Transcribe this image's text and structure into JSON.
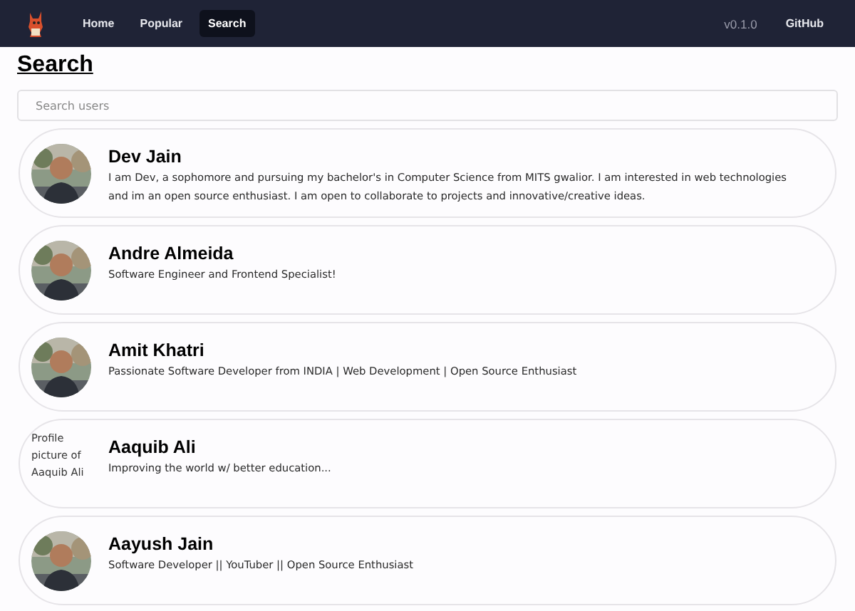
{
  "navbar": {
    "links": [
      {
        "label": "Home",
        "selected": false
      },
      {
        "label": "Popular",
        "selected": false
      },
      {
        "label": "Search",
        "selected": true
      }
    ],
    "version": "v0.1.0",
    "github": "GitHub"
  },
  "heading": "Search",
  "search": {
    "placeholder": "Search users"
  },
  "users": [
    {
      "name": "Dev Jain",
      "bio": "I am Dev, a sophomore and pursuing my bachelor's in Computer Science from MITS gwalior. I am interested in web technologies and im an open source enthusiast. I am open to collaborate to projects and innovative/creative ideas."
    },
    {
      "name": "Andre Almeida",
      "bio": "Software Engineer and Frontend Specialist!"
    },
    {
      "name": "Amit Khatri",
      "bio": "Passionate Software Developer from INDIA | Web Development | Open Source Enthusiast"
    },
    {
      "name": "Aaquib Ali",
      "bio": "Improving the world w/ better education...",
      "avatar": {
        "kind": "broken",
        "alt": "Profile picture of Aaquib Ali"
      }
    },
    {
      "name": "Aayush Jain",
      "bio": "Software Developer || YouTuber || Open Source Enthusiast"
    }
  ]
}
